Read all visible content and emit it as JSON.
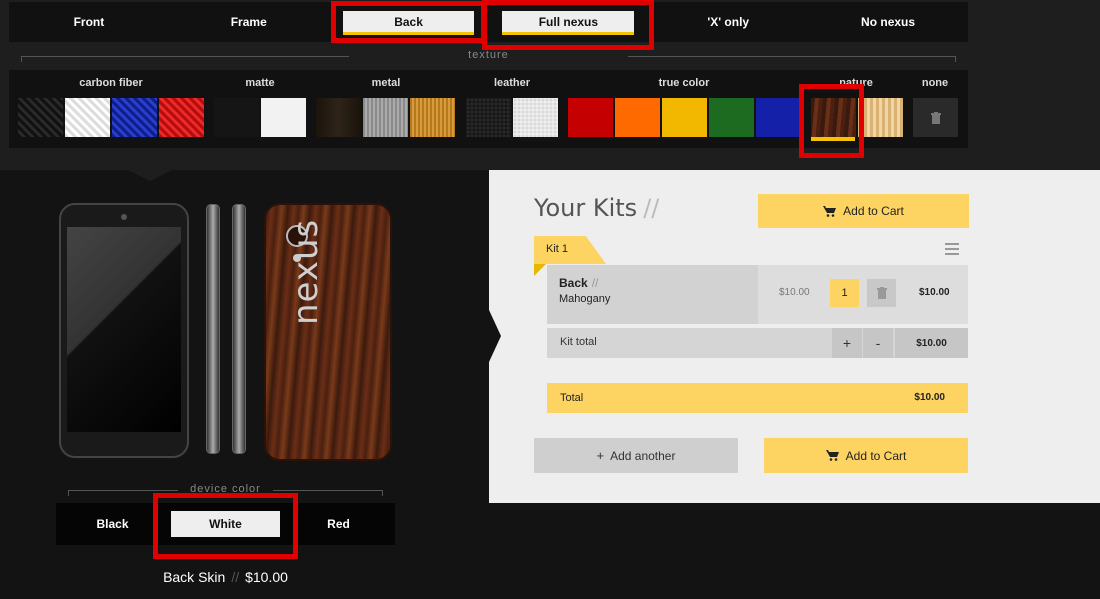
{
  "placement_tabs": [
    {
      "label": "Front",
      "active": false
    },
    {
      "label": "Frame",
      "active": false
    },
    {
      "label": "Back",
      "active": true
    },
    {
      "label": "Full nexus",
      "active": true
    },
    {
      "label": "'X' only",
      "active": false
    },
    {
      "label": "No nexus",
      "active": false
    }
  ],
  "texture": {
    "heading": "texture",
    "groups": [
      {
        "label": "carbon fiber"
      },
      {
        "label": "matte"
      },
      {
        "label": "metal"
      },
      {
        "label": "leather"
      },
      {
        "label": "true color"
      },
      {
        "label": "nature"
      },
      {
        "label": "none"
      }
    ],
    "swatch_colors": {
      "carbon_fiber": [
        "#1c1c1c",
        "#f2f2f2",
        "#1a2fb8",
        "#e21b1b"
      ],
      "matte": [
        "#151515",
        "#f2f2f2"
      ],
      "metal": [
        "#231c12",
        "#9b9b9b",
        "#c7892a"
      ],
      "leather": [
        "#1e1e1e",
        "#e6e6e6"
      ],
      "true_color": [
        "#c50000",
        "#ff6a00",
        "#f2b800",
        "#1d6b20",
        "#1520a8"
      ],
      "nature": [
        "#5b2413",
        "#e8c58a"
      ]
    },
    "selected": "nature-mahogany"
  },
  "device_color": {
    "heading": "device color",
    "options": [
      {
        "label": "Black",
        "active": false
      },
      {
        "label": "White",
        "active": true
      },
      {
        "label": "Red",
        "active": false
      }
    ]
  },
  "summary": {
    "product": "Back Skin",
    "separator": "//",
    "price": "$10.00"
  },
  "phone_logo": "nexus",
  "kits": {
    "title": "Your Kits",
    "title_slashes": "//",
    "add_to_cart": "Add to Cart",
    "kit_label": "Kit 1",
    "item": {
      "name": "Back",
      "slashes": "//",
      "material": "Mahogany",
      "unit_price": "$10.00",
      "quantity": "1",
      "line_total": "$10.00"
    },
    "kit_total_label": "Kit total",
    "plus": "+",
    "minus": "-",
    "kit_total_value": "$10.00",
    "total_label": "Total",
    "total_value": "$10.00",
    "add_another": "Add another",
    "add_another_plus": "+",
    "add_to_cart_bottom": "Add to Cart"
  },
  "colors": {
    "accent_yellow": "#fdd461",
    "highlight_red": "#e00000"
  }
}
